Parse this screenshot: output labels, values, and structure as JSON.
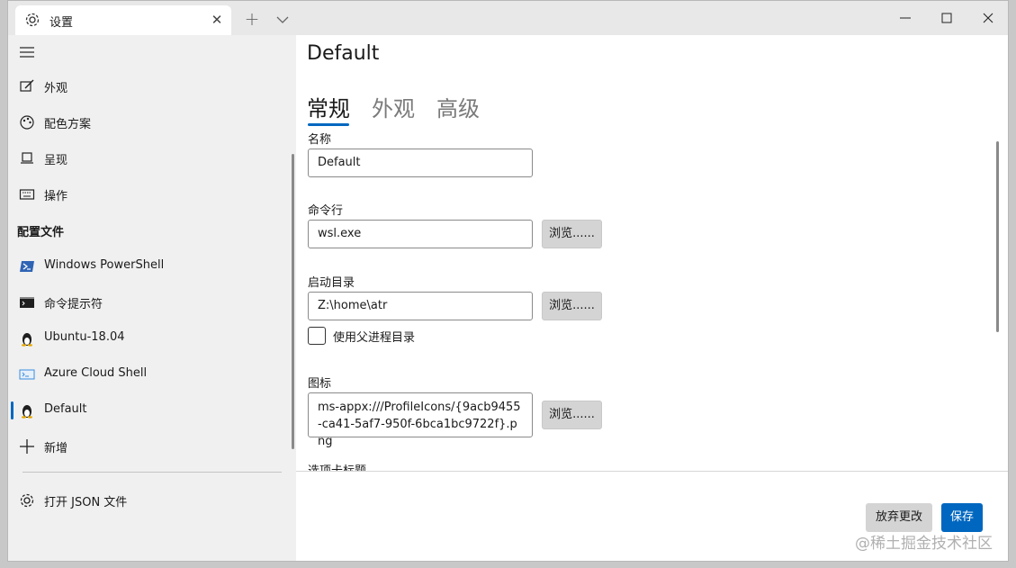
{
  "titlebar": {
    "tab_label": "设置",
    "close_symbol": "✕",
    "new_tab_symbol": "+"
  },
  "sidebar": {
    "items_top": [
      {
        "label": "外观",
        "icon": "appearance-icon"
      },
      {
        "label": "配色方案",
        "icon": "palette-icon"
      },
      {
        "label": "呈现",
        "icon": "rendering-icon"
      },
      {
        "label": "操作",
        "icon": "keyboard-icon"
      }
    ],
    "section_header": "配置文件",
    "profiles": [
      {
        "label": "Windows PowerShell",
        "icon": "powershell-icon"
      },
      {
        "label": "命令提示符",
        "icon": "cmd-icon"
      },
      {
        "label": "Ubuntu-18.04",
        "icon": "linux-penguin-icon"
      },
      {
        "label": "Azure Cloud Shell",
        "icon": "azure-icon"
      },
      {
        "label": "Default",
        "icon": "linux-penguin-icon",
        "selected": true
      }
    ],
    "add_new": "新增",
    "open_json": "打开 JSON 文件"
  },
  "main": {
    "title": "Default",
    "tabs": [
      "常规",
      "外观",
      "高级"
    ],
    "active_tab": "常规",
    "fields": {
      "name_label": "名称",
      "name_value": "Default",
      "cmd_label": "命令行",
      "cmd_value": "wsl.exe",
      "dir_label": "启动目录",
      "dir_value": "Z:\\home\\atr",
      "parent_dir_label": "使用父进程目录",
      "icon_label": "图标",
      "icon_value": "ms-appx:///ProfileIcons/{9acb9455-ca41-5af7-950f-6bca1bc9722f}.png",
      "tab_title_label": "选项卡标题"
    },
    "browse_label": "浏览......",
    "discard_label": "放弃更改",
    "save_label": "保存"
  },
  "watermark": "@稀土掘金技术社区",
  "colors": {
    "accent": "#0067c0",
    "sidebar_bg": "#f0f0f0",
    "titlebar_bg": "#e8e8e8"
  }
}
